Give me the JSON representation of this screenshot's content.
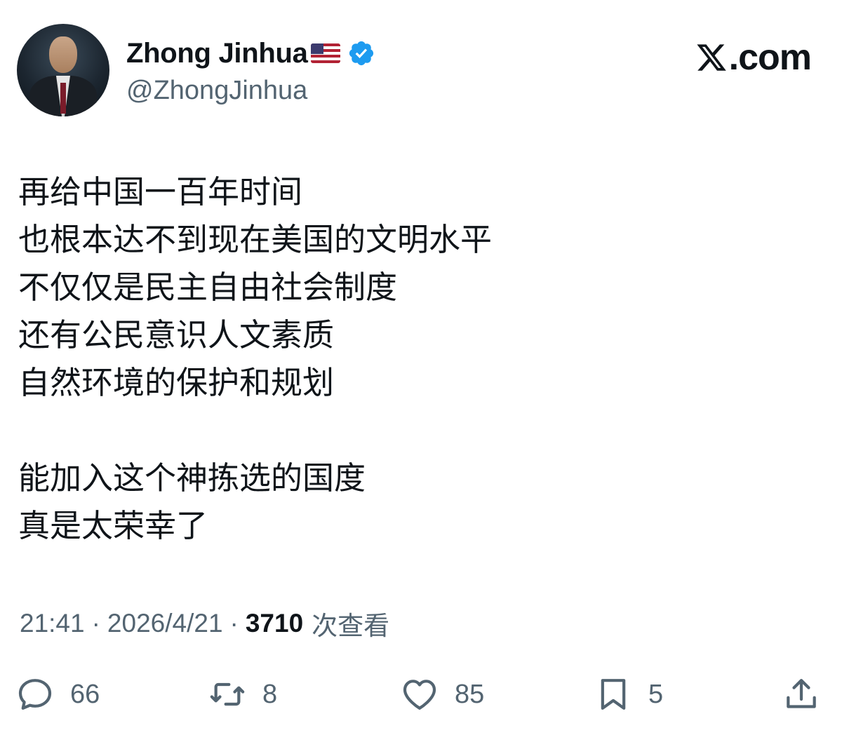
{
  "user": {
    "display_name": "Zhong Jinhua",
    "handle": "@ZhongJinhua",
    "flag_icon": "us-flag-emoji",
    "verified_icon": "verified-badge-icon",
    "verified_color": "#1d9bf0"
  },
  "brand": {
    "logo_text": ".com",
    "logo_icon": "x-logo-icon"
  },
  "tweet": {
    "lines": [
      "再给中国一百年时间",
      "也根本达不到现在美国的文明水平",
      "不仅仅是民主自由社会制度",
      "还有公民意识人文素质",
      "自然环境的保护和规划",
      "",
      "能加入这个神拣选的国度",
      "真是太荣幸了"
    ]
  },
  "meta": {
    "time": "21:41",
    "separator": "·",
    "date": "2026/4/21",
    "views_count": "3710",
    "views_label": "次查看"
  },
  "actions": {
    "replies": {
      "icon": "reply-icon",
      "count": "66"
    },
    "reposts": {
      "icon": "repost-icon",
      "count": "8"
    },
    "likes": {
      "icon": "heart-icon",
      "count": "85"
    },
    "bookmarks": {
      "icon": "bookmark-icon",
      "count": "5"
    },
    "share": {
      "icon": "share-icon"
    }
  },
  "colors": {
    "text_primary": "#0f1419",
    "text_secondary": "#536471",
    "background": "#ffffff"
  }
}
